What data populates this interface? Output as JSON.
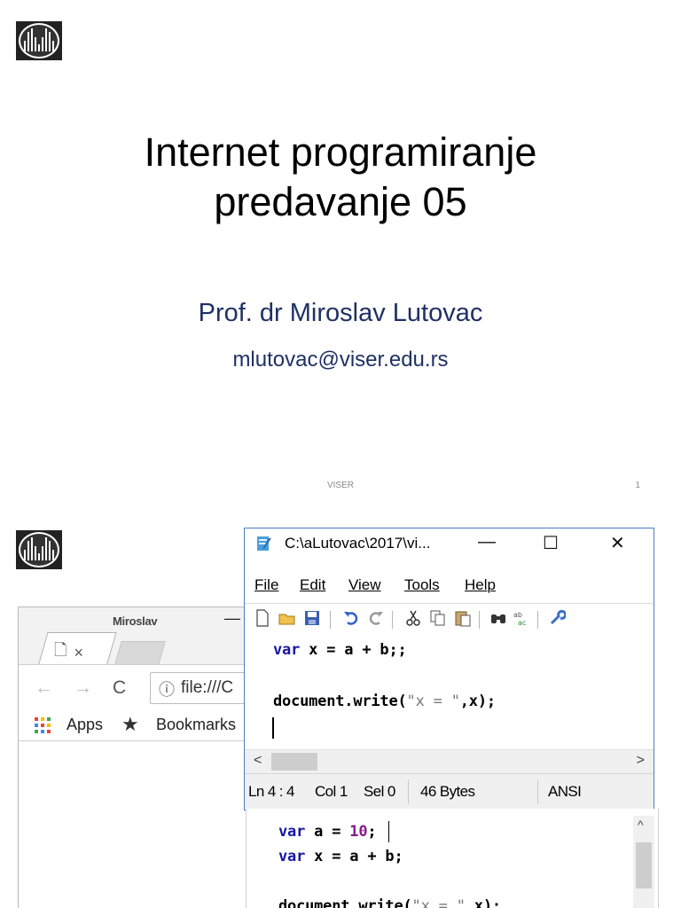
{
  "slide1": {
    "title_line1": "Internet programiranje",
    "title_line2": "predavanje 05",
    "author": "Prof. dr Miroslav Lutovac",
    "email": "mlutovac@viser.edu.rs",
    "footer_center": "VISER",
    "page_number": "1"
  },
  "chrome": {
    "profile_name": "Miroslav",
    "minimize": "—",
    "tab_close": "×",
    "back": "←",
    "forward": "→",
    "reload": "C",
    "info_icon": "ⓘ",
    "url": "file:///C",
    "apps_label": "Apps",
    "bookmarks_label": "Bookmarks"
  },
  "notepad_top": {
    "title": "C:\\aLutovac\\2017\\vi...",
    "minimize": "—",
    "maximize": "☐",
    "close": "✕",
    "menu": {
      "file": "File",
      "edit": "Edit",
      "view": "View",
      "tools": "Tools",
      "help": "Help"
    },
    "code": {
      "line1_kw": "var",
      "line1_rest": " x = a + b;;",
      "line3_fn": "document.write(",
      "line3_str": "\"x = \"",
      "line3_rest": ",x);"
    },
    "status": {
      "ln": "Ln 4 : 4",
      "col": "Col 1",
      "sel": "Sel 0",
      "bytes": "46 Bytes",
      "encoding": "ANSI"
    }
  },
  "notepad_bottom": {
    "code": {
      "line1_kw": "var",
      "line1_mid": " a = ",
      "line1_num": "10",
      "line1_end": ";",
      "line2_kw": "var",
      "line2_rest": " x = a + b;",
      "line4_fn": "document.write(",
      "line4_str": "\"x = \"",
      "line4_rest": ",x);"
    }
  }
}
